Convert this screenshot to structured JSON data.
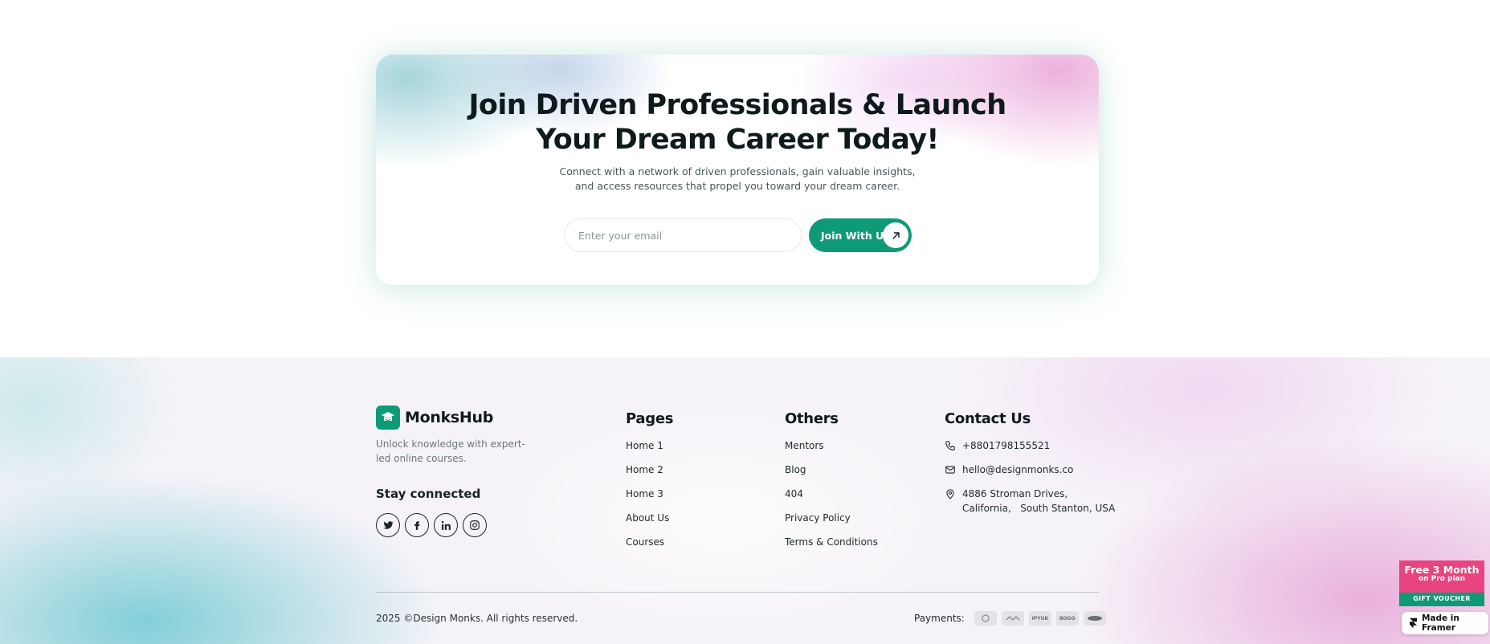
{
  "cta": {
    "title_line1": "Join Driven Professionals & Launch",
    "title_line2": "Your Dream Career Today!",
    "subtitle": "Connect with a network of driven professionals, gain valuable insights, and access resources that propel you toward your dream career.",
    "email_placeholder": "Enter your email",
    "button_label": "Join With Us",
    "button_icon": "arrow-up-right-icon"
  },
  "footer": {
    "brand": {
      "name": "MonksHub",
      "description": "Unlock knowledge with expert-led online courses.",
      "stay_connected": "Stay connected",
      "socials": [
        "twitter-icon",
        "facebook-icon",
        "linkedin-icon",
        "instagram-icon"
      ]
    },
    "pages": {
      "title": "Pages",
      "links": [
        "Home 1",
        "Home 2",
        "Home 3",
        "About Us",
        "Courses"
      ]
    },
    "others": {
      "title": "Others",
      "links": [
        "Mentors",
        "Blog",
        "404",
        "Privacy Policy",
        "Terms & Conditions"
      ]
    },
    "contact": {
      "title": "Contact Us",
      "phone": "+8801798155521",
      "email": "hello@designmonks.co",
      "address_line1": "4886 Stroman Drives,",
      "address_line2": "California,   South Stanton, USA"
    },
    "copyright": "2025 ©Design Monks. All rights reserved.",
    "payments_label": "Payments:",
    "payment_methods": [
      "payment-logo-1",
      "payment-logo-2",
      "IPYUK",
      "BOGO",
      "payment-logo-5"
    ]
  },
  "promo": {
    "line1": "Free 3 Month",
    "line2": "on Pro plan",
    "voucher": "GIFT VOUCHER"
  },
  "framer_badge": "Made in Framer",
  "colors": {
    "accent": "#0e9a77",
    "promo_pink": "#e8447f",
    "text_dark": "#0e1a1b"
  }
}
